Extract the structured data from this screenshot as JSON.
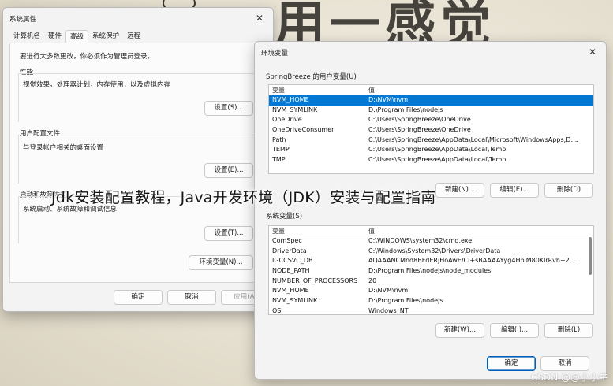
{
  "background": {
    "calligraphy": "用一感觉"
  },
  "sysprops": {
    "title": "系统属性",
    "tabs": [
      "计算机名",
      "硬件",
      "高级",
      "系统保护",
      "远程"
    ],
    "admin_note": "要进行大多数更改，你必须作为管理员登录。",
    "performance": {
      "label": "性能",
      "desc": "视觉效果，处理器计划，内存使用，以及虚拟内存",
      "button": "设置(S)..."
    },
    "profiles": {
      "label": "用户配置文件",
      "desc": "与登录帐户相关的桌面设置",
      "button": "设置(E)..."
    },
    "startup": {
      "label": "启动和故障恢复",
      "desc": "系统启动、系统故障和调试信息",
      "button": "设置(T)..."
    },
    "env_button": "环境变量(N)...",
    "ok": "确定",
    "cancel": "取消",
    "apply": "应用(A)"
  },
  "envvars": {
    "title": "环境变量",
    "user_section": "SpringBreeze 的用户变量(U)",
    "columns": [
      "变量",
      "值"
    ],
    "user_vars": [
      [
        "NVM_HOME",
        "D:\\NVM\\nvm"
      ],
      [
        "NVM_SYMLINK",
        "D:\\Program Files\\nodejs"
      ],
      [
        "OneDrive",
        "C:\\Users\\SpringBreeze\\OneDrive"
      ],
      [
        "OneDriveConsumer",
        "C:\\Users\\SpringBreeze\\OneDrive"
      ],
      [
        "Path",
        "C:\\Users\\SpringBreeze\\AppData\\Local\\Microsoft\\WindowsApps;D:..."
      ],
      [
        "TEMP",
        "C:\\Users\\SpringBreeze\\AppData\\Local\\Temp"
      ],
      [
        "TMP",
        "C:\\Users\\SpringBreeze\\AppData\\Local\\Temp"
      ]
    ],
    "user_selected_index": 0,
    "user_buttons": [
      "新建(N)...",
      "编辑(E)...",
      "删除(D)"
    ],
    "system_section": "系统变量(S)",
    "system_vars": [
      [
        "ComSpec",
        "C:\\WINDOWS\\system32\\cmd.exe"
      ],
      [
        "DriverData",
        "C:\\Windows\\System32\\Drivers\\DriverData"
      ],
      [
        "IGCCSVC_DB",
        "AQAAANCMnd8BFdERjHoAwE/Cl+sBAAAAYyg4HbiM80KlrRvh+2..."
      ],
      [
        "NODE_PATH",
        "D:\\Program Files\\nodejs\\node_modules"
      ],
      [
        "NUMBER_OF_PROCESSORS",
        "20"
      ],
      [
        "NVM_HOME",
        "D:\\NVM\\nvm"
      ],
      [
        "NVM_SYMLINK",
        "D:\\Program Files\\nodejs"
      ],
      [
        "OS",
        "Windows_NT"
      ]
    ],
    "system_buttons": [
      "新建(W)...",
      "编辑(I)...",
      "删除(L)"
    ],
    "ok": "确定",
    "cancel": "取消"
  },
  "caption": "Jdk安装配置教程，Java开发环境（JDK）安装与配置指南",
  "watermark": "CSDN @@小小牛"
}
